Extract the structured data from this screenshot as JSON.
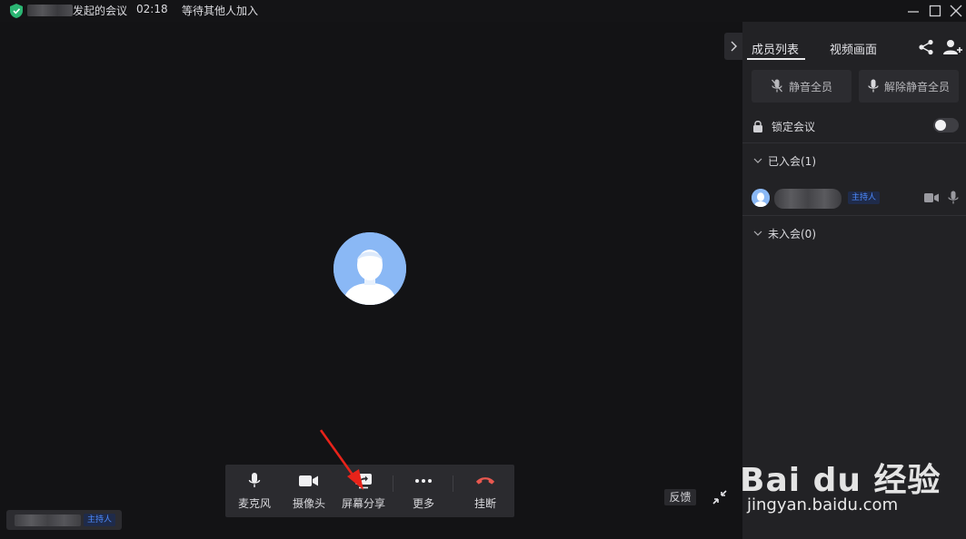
{
  "titlebar": {
    "meeting_title": "发起的会议",
    "timer": "02:18",
    "status": "等待其他人加入"
  },
  "colors": {
    "accent_blue": "#4d8bff",
    "hangup_red": "#e8584f",
    "shield_green": "#2bb673",
    "annotation_red": "#e8231a"
  },
  "video": {
    "self_label_badge": "主持人"
  },
  "toolbar": {
    "items": [
      {
        "label": "麦克风",
        "icon": "microphone-icon"
      },
      {
        "label": "摄像头",
        "icon": "camera-icon"
      },
      {
        "label": "屏幕分享",
        "icon": "screen-share-icon"
      },
      {
        "label": "更多",
        "icon": "more-icon"
      },
      {
        "label": "挂断",
        "icon": "hangup-icon"
      }
    ]
  },
  "feedback_label": "反馈",
  "panel": {
    "tabs": [
      {
        "label": "成员列表",
        "active": true
      },
      {
        "label": "视频画面",
        "active": false
      }
    ],
    "mute_all": "静音全员",
    "unmute_all": "解除静音全员",
    "lock_meeting": "锁定会议",
    "lock_enabled": false,
    "joined_section": "已入会(1)",
    "not_joined_section": "未入会(0)",
    "members": [
      {
        "role_badge": "主持人"
      }
    ]
  },
  "watermark": {
    "brand": "Bai du 经验",
    "url": "jingyan.baidu.com"
  }
}
